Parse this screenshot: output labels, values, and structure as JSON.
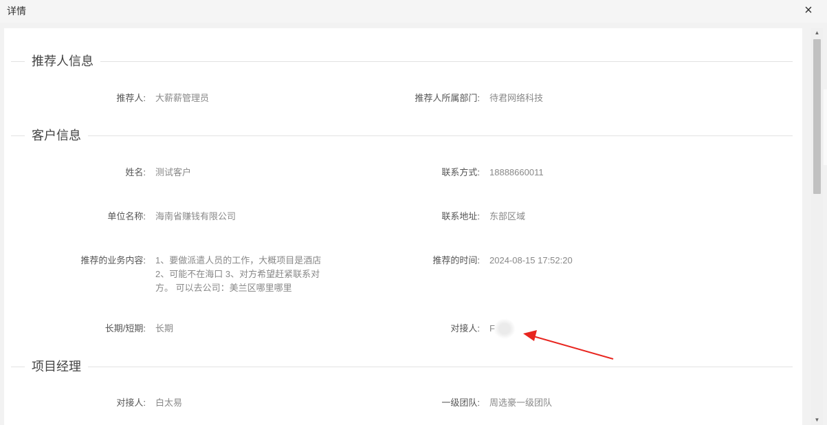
{
  "dialog": {
    "title": "详情",
    "close_glyph": "×"
  },
  "sections": {
    "referrer": {
      "title": "推荐人信息",
      "fields": [
        {
          "label": "推荐人:",
          "value": "大薪薪管理员"
        },
        {
          "label": "推荐人所属部门:",
          "value": "待君网络科技"
        }
      ]
    },
    "customer": {
      "title": "客户信息",
      "fields": [
        {
          "label": "姓名:",
          "value": "测试客户"
        },
        {
          "label": "联系方式:",
          "value": "18888660011"
        },
        {
          "label": "单位名称:",
          "value": "海南省赚钱有限公司"
        },
        {
          "label": "联系地址:",
          "value": "东部区域"
        },
        {
          "label": "推荐的业务内容:",
          "value": "1、要做派遣人员的工作，大概项目是酒店 2、可能不在海口 3、对方希望赶紧联系对方。 可以去公司：美兰区哪里哪里"
        },
        {
          "label": "推荐的时间:",
          "value": "2024-08-15 17:52:20"
        },
        {
          "label": "长期/短期:",
          "value": "长期"
        },
        {
          "label": "对接人:",
          "value": "F"
        }
      ]
    },
    "pm": {
      "title": "项目经理",
      "fields": [
        {
          "label": "对接人:",
          "value": "白太易"
        },
        {
          "label": "一级团队:",
          "value": "周选豪一级团队"
        }
      ]
    }
  },
  "icons": {
    "close": "close-icon",
    "scroll_up": "scroll-up-icon",
    "scroll_down": "scroll-down-icon"
  },
  "colors": {
    "annotation_arrow": "#e8251f"
  }
}
